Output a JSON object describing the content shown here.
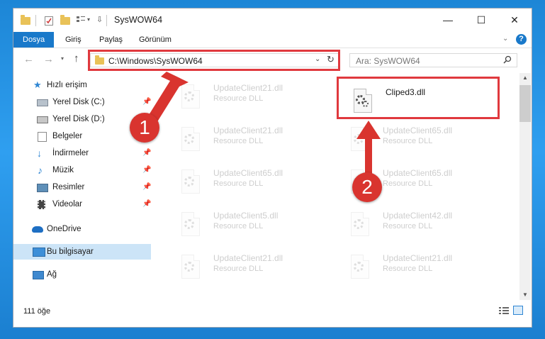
{
  "window": {
    "title": "SysWOW64",
    "minimize": "—",
    "maximize": "☐",
    "close": "✕"
  },
  "ribbon": {
    "tabs": [
      "Dosya",
      "Giriş",
      "Paylaş",
      "Görünüm"
    ],
    "help": "?"
  },
  "address": {
    "path": "C:\\Windows\\SysWOW64",
    "search_placeholder": "Ara: SysWOW64"
  },
  "nav": {
    "items": [
      {
        "label": "Hızlı erişim"
      },
      {
        "label": "Yerel Disk (C:)"
      },
      {
        "label": "Yerel Disk (D:)"
      },
      {
        "label": "Belgeler"
      },
      {
        "label": "İndirmeler"
      },
      {
        "label": "Müzik"
      },
      {
        "label": "Resimler"
      },
      {
        "label": "Videolar"
      },
      {
        "label": "OneDrive"
      },
      {
        "label": "Bu bilgisayar"
      },
      {
        "label": "Ağ"
      }
    ]
  },
  "files": {
    "highlighted": {
      "name": "Cliped3.dll"
    },
    "faded": [
      {
        "name": "UpdateClient21.dll",
        "type": "Resource DLL"
      },
      {
        "name": "UpdateClient21.dll",
        "type": "Resource DLL"
      },
      {
        "name": "UpdateClient65.dll",
        "type": "Resource DLL"
      },
      {
        "name": "UpdateClient65.dll",
        "type": "Resource DLL"
      },
      {
        "name": "UpdateClient65.dll",
        "type": "Resource DLL"
      },
      {
        "name": "UpdateClient5.dll",
        "type": "Resource DLL"
      },
      {
        "name": "UpdateClient42.dll",
        "type": "Resource DLL"
      },
      {
        "name": "UpdateClient21.dll",
        "type": "Resource DLL"
      },
      {
        "name": "UpdateClient21.dll",
        "type": "Resource DLL"
      }
    ]
  },
  "status": {
    "count": "111 öğe"
  },
  "callouts": {
    "one": "1",
    "two": "2"
  },
  "colors": {
    "accent": "#1979ca",
    "highlight_red": "#e0393e",
    "bubble_red": "#d9342f",
    "desktop": "#2f9ff0"
  }
}
